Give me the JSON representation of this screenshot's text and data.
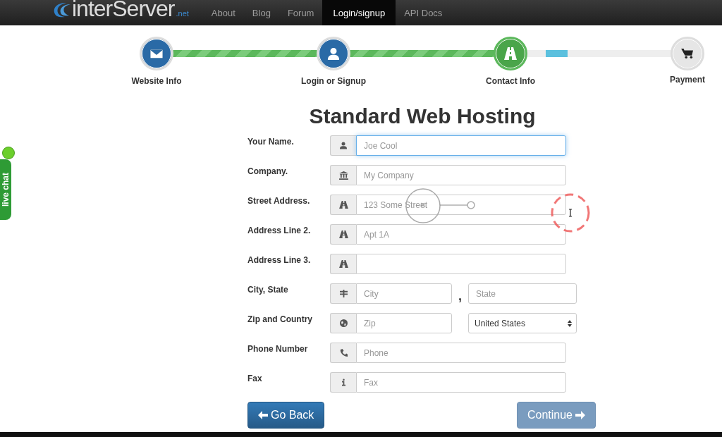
{
  "navbar": {
    "logo": {
      "name": "interServer",
      "suffix": ".net"
    },
    "items": [
      {
        "label": "About",
        "selected": false
      },
      {
        "label": "Blog",
        "selected": false
      },
      {
        "label": "Forum",
        "selected": false
      },
      {
        "label": "Login/signup",
        "selected": true
      },
      {
        "label": "API Docs",
        "selected": false
      }
    ]
  },
  "live_chat": {
    "label": "live chat"
  },
  "steps": [
    {
      "label": "Website Info",
      "done": true,
      "selected": false
    },
    {
      "label": "Login or Signup",
      "done": true,
      "selected": false
    },
    {
      "label": "Contact Info",
      "done": false,
      "selected": true,
      "level": 0.15
    },
    {
      "label": "Payment",
      "done": false,
      "selected": false
    }
  ],
  "title": "Standard Web Hosting",
  "form": [
    {
      "kind": "single",
      "label": "Your Name.",
      "placeholder": "Joe Cool",
      "focused": true
    },
    {
      "kind": "single",
      "label": "Company.",
      "placeholder": "My Company",
      "focused": false
    },
    {
      "kind": "single",
      "label": "Street Address.",
      "placeholder": "123 Some Street",
      "focused": false
    },
    {
      "kind": "single",
      "label": "Address Line 2.",
      "placeholder": "Apt 1A",
      "focused": false
    },
    {
      "kind": "single",
      "label": "Address Line 3.",
      "focused": false
    },
    {
      "kind": "pair",
      "label": "City, State",
      "placeholder": "City",
      "separator": ",",
      "second_placeholder": "State",
      "focused": false
    },
    {
      "kind": "select",
      "label": "Zip and Country",
      "placeholder": "Zip",
      "value": "United States",
      "focused": false
    },
    {
      "kind": "single",
      "label": "Phone Number",
      "placeholder": "Phone",
      "focused": false
    },
    {
      "kind": "single",
      "label": "Fax",
      "placeholder": "Fax",
      "focused": false
    }
  ],
  "buttons": [
    {
      "label": "Go Back",
      "kind": "back",
      "disabled": false
    },
    {
      "label": "Continue",
      "kind": "next",
      "disabled": true
    }
  ]
}
